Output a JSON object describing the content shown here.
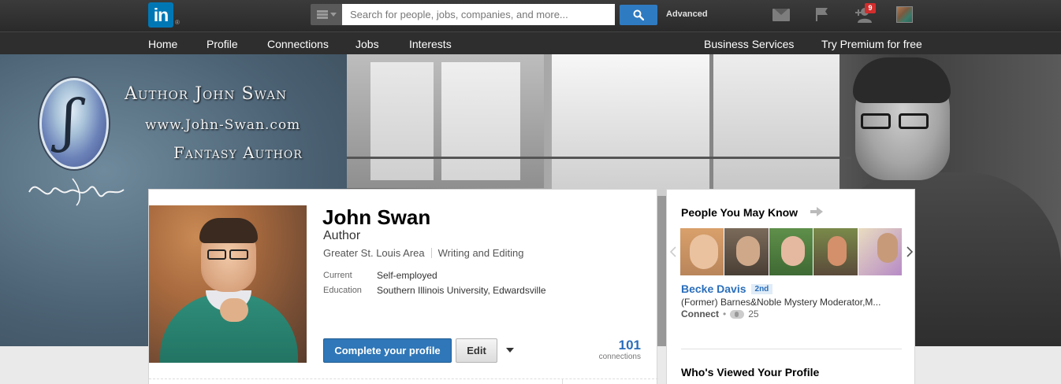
{
  "topbar": {
    "logo": "in",
    "logo_reg": "®",
    "search_placeholder": "Search for people, jobs, companies, and more...",
    "advanced": "Advanced",
    "notification_count": "9"
  },
  "nav": {
    "left": [
      "Home",
      "Profile",
      "Connections",
      "Jobs",
      "Interests"
    ],
    "right": [
      "Business Services",
      "Try Premium for free"
    ]
  },
  "banner": {
    "title": "Author John Swan",
    "url": "www.John-Swan.com",
    "subtitle": "Fantasy Author"
  },
  "profile": {
    "name": "John Swan",
    "headline": "Author",
    "location": "Greater St. Louis Area",
    "industry": "Writing and Editing",
    "current_label": "Current",
    "current_value": "Self-employed",
    "education_label": "Education",
    "education_value": "Southern Illinois University, Edwardsville",
    "complete_button": "Complete your profile",
    "edit_button": "Edit",
    "connections_count": "101",
    "connections_label": "connections"
  },
  "sidebar": {
    "pymk_title": "People You May Know",
    "suggestion": {
      "name": "Becke Davis",
      "degree": "2nd",
      "headline": "(Former) Barnes&Noble Mystery Moderator,M...",
      "connect": "Connect",
      "separator": "•",
      "shared_count": "25"
    },
    "viewed_title": "Who's Viewed Your Profile"
  },
  "colors": {
    "linkedin_blue": "#0077b5",
    "primary_button": "#2f77b8",
    "link_blue": "#2a6ebb",
    "badge_red": "#d12d2d"
  }
}
